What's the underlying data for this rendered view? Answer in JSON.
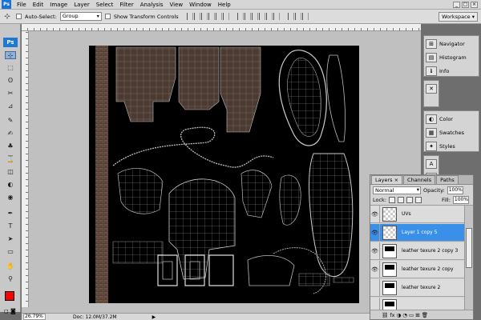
{
  "app": {
    "logo": "Ps"
  },
  "menu": {
    "items": [
      "File",
      "Edit",
      "Image",
      "Layer",
      "Select",
      "Filter",
      "Analysis",
      "View",
      "Window",
      "Help"
    ],
    "win_controls": [
      "_",
      "□",
      "×"
    ]
  },
  "options": {
    "tool_glyph": "⊹",
    "auto_select_label": "Auto-Select:",
    "auto_select_value": "Group",
    "show_transform_label": "Show Transform Controls",
    "workspace_label": "Workspace ▾"
  },
  "tools": {
    "badge": "Ps",
    "glyphs": [
      "⊹",
      "⬚",
      "ʘ",
      "✂",
      "⊿",
      "✎",
      "✍",
      "♣",
      "⌛",
      "◫",
      "◐",
      "◉",
      "✒",
      "T",
      "➤",
      "▭",
      "✋",
      "⚲"
    ],
    "quickmask": "◻ ◙"
  },
  "document": {
    "zoom": "26.79%",
    "doc_size": "Doc: 12.0M/37.2M",
    "status_arrow": "▶"
  },
  "dock": {
    "navigator": "Navigator",
    "histogram": "Histogram",
    "info": "Info",
    "color": "Color",
    "swatches": "Swatches",
    "styles": "Styles",
    "icons": {
      "navigator": "⊞",
      "histogram": "▤",
      "info": "ℹ",
      "color": "◐",
      "swatches": "▦",
      "styles": "✦",
      "tool_a": "✕",
      "char": "A",
      "para": "¶"
    }
  },
  "layers_panel": {
    "tabs": [
      "Layers ×",
      "Channels",
      "Paths"
    ],
    "blend_mode": "Normal",
    "opacity_label": "Opacity:",
    "opacity_value": "100%",
    "lock_label": "Lock:",
    "fill_label": "Fill:",
    "fill_value": "100%",
    "layers": [
      {
        "name": "UVs",
        "visible": true,
        "selected": false
      },
      {
        "name": "Layer 1 copy 5",
        "visible": true,
        "selected": true
      },
      {
        "name": "leather texure 2 copy 3",
        "visible": true,
        "selected": false
      },
      {
        "name": "leather texure 2 copy",
        "visible": true,
        "selected": false
      },
      {
        "name": "leather texure 2",
        "visible": false,
        "selected": false
      },
      {
        "name": "",
        "visible": false,
        "selected": false
      }
    ],
    "footer_icons": "⛓ fx ◑ ◔ ▭ ⊞ 🗑"
  },
  "colors": {
    "foreground": "#ff0000",
    "background": "#000000",
    "accent": "#3a8fe8"
  }
}
